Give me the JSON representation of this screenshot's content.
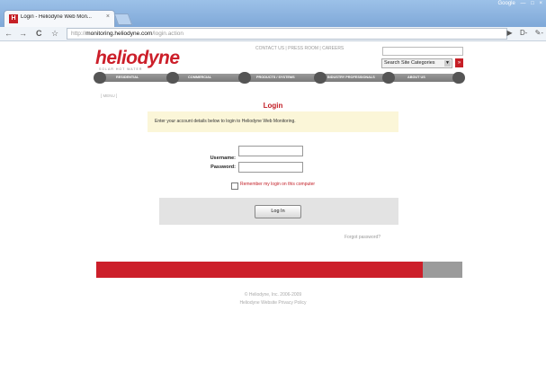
{
  "browser": {
    "tab_title": "Login - Heliodyne Web Mon...",
    "tab_favicon": "H",
    "tab_close": "×",
    "window_controls": [
      "Google",
      "—",
      "□",
      "×"
    ],
    "url_scheme": "http://",
    "url_host": "monitoring.heliodyne.com",
    "url_path": "/login.action",
    "back_icon": "←",
    "forward_icon": "→",
    "reload_icon": "C",
    "star_icon": "☆",
    "page_icon": "▶",
    "menu_icon": "D-",
    "wrench_icon": "✎-"
  },
  "site": {
    "logo": "heliodyne",
    "tagline": "SOLAR HOT WATER",
    "top_links": "CONTACT US | PRESS ROOM | CAREERS",
    "search_select": "Search Site Categories",
    "search_dd": "▼",
    "search_go": "»",
    "nav_items": [
      "RESIDENTIAL",
      "COMMERCIAL",
      "PRODUCTS / SYSTEMS",
      "INDUSTRY PROFESSIONALS",
      "ABOUT US"
    ]
  },
  "login": {
    "menu_link": "[ MENU ]",
    "title": "Login",
    "instructions": "Enter your account details below to login to Heliodyne Web Monitoring.",
    "username_label": "Username:",
    "password_label": "Password:",
    "remember_label": "Remember my login on this computer",
    "login_button": "Log In",
    "forgot_link": "Forgot password?"
  },
  "footer": {
    "copyright": "© Heliodyne, Inc. 2006-2009",
    "privacy": "Heliodyne Website Privacy Policy"
  },
  "colors": {
    "brand_red": "#cc1f2a",
    "notice_bg": "#fbf6d8"
  }
}
